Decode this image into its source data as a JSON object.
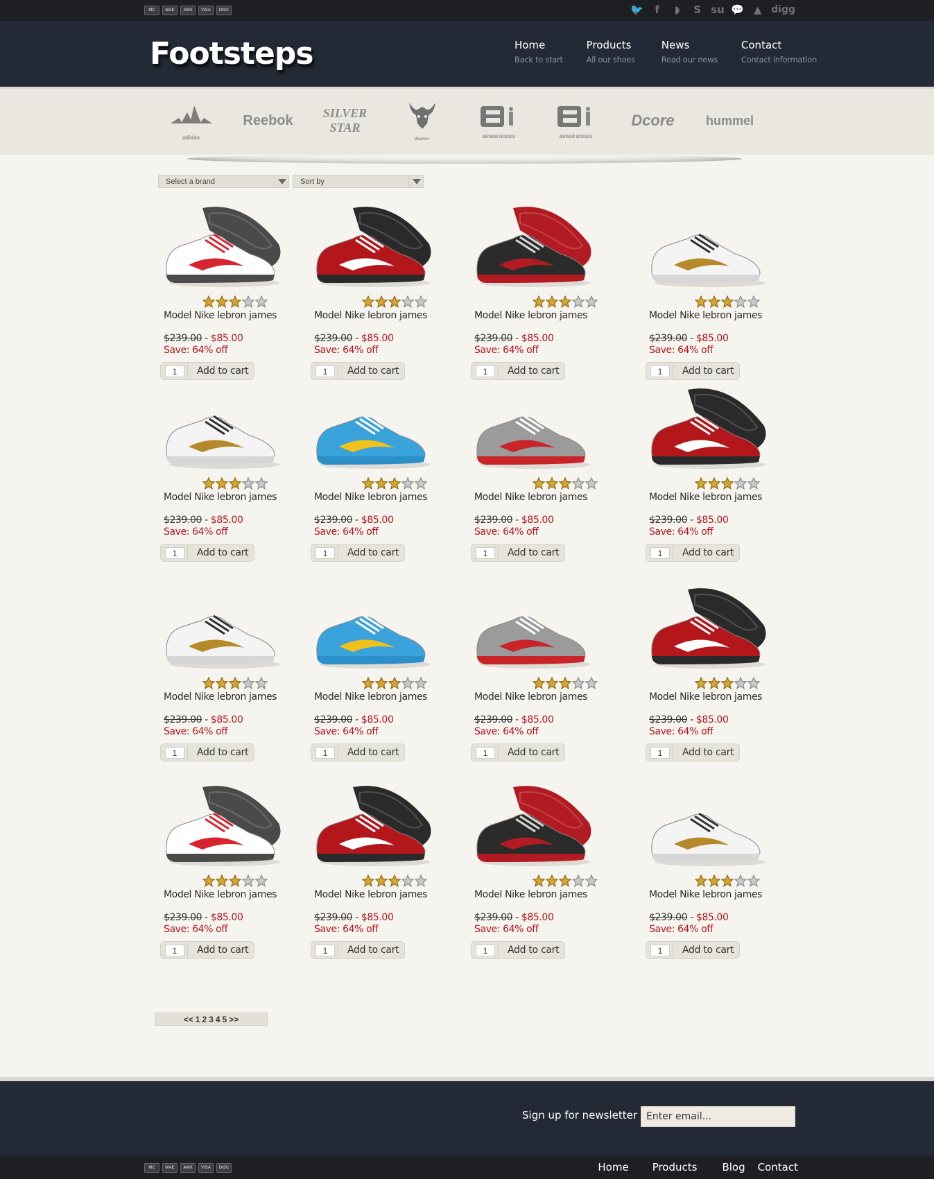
{
  "payment_icons": [
    "mastercard-icon",
    "maestro-icon",
    "amex-icon",
    "visa-icon",
    "discover-icon"
  ],
  "payment_labels": [
    "MC",
    "MAE",
    "AMX",
    "VISA",
    "DISC"
  ],
  "social": [
    {
      "name": "twitter-icon",
      "glyph": "🐦"
    },
    {
      "name": "facebook-icon",
      "glyph": "f"
    },
    {
      "name": "rss-icon",
      "glyph": "◗"
    },
    {
      "name": "skype-icon",
      "glyph": "S"
    },
    {
      "name": "stumbleupon-icon",
      "glyph": "su"
    },
    {
      "name": "chat-icon",
      "glyph": "💬"
    },
    {
      "name": "delicious-icon",
      "glyph": "▲"
    },
    {
      "name": "digg-icon",
      "glyph": "digg"
    }
  ],
  "logo": "Footsteps",
  "nav": [
    {
      "title": "Home",
      "subtitle": "Back to start"
    },
    {
      "title": "Products",
      "subtitle": "All our shoes"
    },
    {
      "title": "News",
      "subtitle": "Read our news"
    },
    {
      "title": "Contact",
      "subtitle": "Contact information"
    }
  ],
  "brands": [
    "adidas",
    "Reebok",
    "SILVER STAR",
    "Warrior",
    "BEWER BODIES",
    "BEWER BODIES",
    "Dcore",
    "hummel"
  ],
  "filters": {
    "brand": "Select a brand",
    "sort": "Sort by"
  },
  "products": [
    {
      "title": "Model Nike lebron james",
      "old_price": "$239.00",
      "new_price": "$85.00",
      "save": "Save: 64% off",
      "qty": "1",
      "cart": "Add to cart",
      "rating": 3,
      "image": "dc-white-red"
    },
    {
      "title": "Model Nike lebron james",
      "old_price": "$239.00",
      "new_price": "$85.00",
      "save": "Save: 64% off",
      "qty": "1",
      "cart": "Add to cart",
      "rating": 3,
      "image": "nike-red-low"
    },
    {
      "title": "Model Nike lebron james",
      "old_price": "$239.00",
      "new_price": "$85.00",
      "save": "Save: 64% off",
      "qty": "1",
      "cart": "Add to cart",
      "rating": 3,
      "image": "lebron-black-red"
    },
    {
      "title": "Model Nike lebron james",
      "old_price": "$239.00",
      "new_price": "$85.00",
      "save": "Save: 64% off",
      "qty": "1",
      "cart": "Add to cart",
      "rating": 3,
      "image": "kobe-white-gold"
    },
    {
      "title": "Model Nike lebron james",
      "old_price": "$239.00",
      "new_price": "$85.00",
      "save": "Save: 64% off",
      "qty": "1",
      "cart": "Add to cart",
      "rating": 3,
      "image": "kobe-white-gold"
    },
    {
      "title": "Model Nike lebron james",
      "old_price": "$239.00",
      "new_price": "$85.00",
      "save": "Save: 64% off",
      "qty": "1",
      "cart": "Add to cart",
      "rating": 3,
      "image": "adidas-blue"
    },
    {
      "title": "Model Nike lebron james",
      "old_price": "$239.00",
      "new_price": "$85.00",
      "save": "Save: 64% off",
      "qty": "1",
      "cart": "Add to cart",
      "rating": 3,
      "image": "adidas-grey-red"
    },
    {
      "title": "Model Nike lebron james",
      "old_price": "$239.00",
      "new_price": "$85.00",
      "save": "Save: 64% off",
      "qty": "1",
      "cart": "Add to cart",
      "rating": 3,
      "image": "nike-red-low"
    },
    {
      "title": "Model Nike lebron james",
      "old_price": "$239.00",
      "new_price": "$85.00",
      "save": "Save: 64% off",
      "qty": "1",
      "cart": "Add to cart",
      "rating": 3,
      "image": "kobe-white-gold"
    },
    {
      "title": "Model Nike lebron james",
      "old_price": "$239.00",
      "new_price": "$85.00",
      "save": "Save: 64% off",
      "qty": "1",
      "cart": "Add to cart",
      "rating": 3,
      "image": "adidas-blue"
    },
    {
      "title": "Model Nike lebron james",
      "old_price": "$239.00",
      "new_price": "$85.00",
      "save": "Save: 64% off",
      "qty": "1",
      "cart": "Add to cart",
      "rating": 3,
      "image": "adidas-grey-red"
    },
    {
      "title": "Model Nike lebron james",
      "old_price": "$239.00",
      "new_price": "$85.00",
      "save": "Save: 64% off",
      "qty": "1",
      "cart": "Add to cart",
      "rating": 3,
      "image": "nike-red-low"
    },
    {
      "title": "Model Nike lebron james",
      "old_price": "$239.00",
      "new_price": "$85.00",
      "save": "Save: 64% off",
      "qty": "1",
      "cart": "Add to cart",
      "rating": 3,
      "image": "dc-white-red"
    },
    {
      "title": "Model Nike lebron james",
      "old_price": "$239.00",
      "new_price": "$85.00",
      "save": "Save: 64% off",
      "qty": "1",
      "cart": "Add to cart",
      "rating": 3,
      "image": "nike-red-low"
    },
    {
      "title": "Model Nike lebron james",
      "old_price": "$239.00",
      "new_price": "$85.00",
      "save": "Save: 64% off",
      "qty": "1",
      "cart": "Add to cart",
      "rating": 3,
      "image": "lebron-black-red"
    },
    {
      "title": "Model Nike lebron james",
      "old_price": "$239.00",
      "new_price": "$85.00",
      "save": "Save: 64% off",
      "qty": "1",
      "cart": "Add to cart",
      "rating": 3,
      "image": "kobe-white-gold"
    }
  ],
  "pager": {
    "prev": "<<",
    "pages": [
      "1",
      "2",
      "3",
      "4",
      "5"
    ],
    "next": ">>"
  },
  "newsletter": {
    "label": "Sign up for newsletter",
    "placeholder": "Enter email..."
  },
  "footer_nav": [
    "Home",
    "Products",
    "Blog",
    "Contact"
  ],
  "colors": {
    "header_bg": "#242a35",
    "topbar_bg": "#1d1f22",
    "price_red": "#b3151b",
    "page_bg": "#f6f4ef"
  }
}
